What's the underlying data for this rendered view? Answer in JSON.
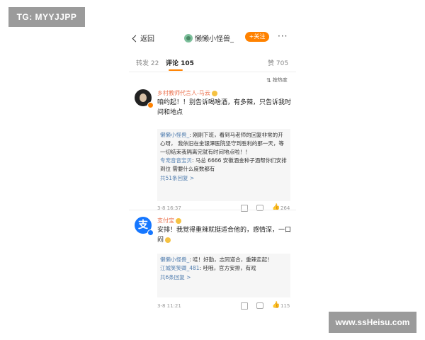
{
  "watermarks": {
    "top_left": "TG: MYYJJPP",
    "bottom_right": "www.ssHeisu.com"
  },
  "nav": {
    "back_label": "返回",
    "title": "懒懒小怪兽_",
    "follow_label": "+关注",
    "more_label": "···"
  },
  "tabs": {
    "repost": "转发 22",
    "comment": "评论 105",
    "like": "赞 705",
    "sort_label": "按热度"
  },
  "comments": [
    {
      "username": "乡村教师代言人-马云",
      "text": "咱约起！！别告诉喝啥酒，有多辣，只告诉我时间和地点",
      "replies": [
        {
          "name": "懒懒小怪兽_",
          "text": ": 刚刚下班，看到马老师的回复非常的开心呀， 我依旧在金银潭医院坚守到胜利的那一天，等一切结束我隔离完就有时间地点啦！！"
        },
        {
          "name": "专宠音音宝贝",
          "text": ": 马总 6666 安徽酒金种子酒帮你们安排到位 需要什么度数都有"
        }
      ],
      "more_replies": "共51条回复 >",
      "time": "3-8 16:37",
      "likes": "264"
    },
    {
      "username": "支付宝",
      "text": "安排！我觉得重辣就挺适合他的，感情深，一口闷",
      "replies": [
        {
          "name": "懒懒小怪兽_",
          "text": ": 哇！好勤，志同道合，重辣走起！"
        },
        {
          "name": "江城笑笑卿_481",
          "text": ": 哇哦，官方安排，有戏"
        }
      ],
      "more_replies": "共6条回复 >",
      "time": "3-8 11:21",
      "likes": "115"
    }
  ],
  "colors": {
    "accent": "#ff8200",
    "username": "#eb7350",
    "link": "#507daf"
  },
  "icons": {
    "alipay_glyph": "支"
  }
}
